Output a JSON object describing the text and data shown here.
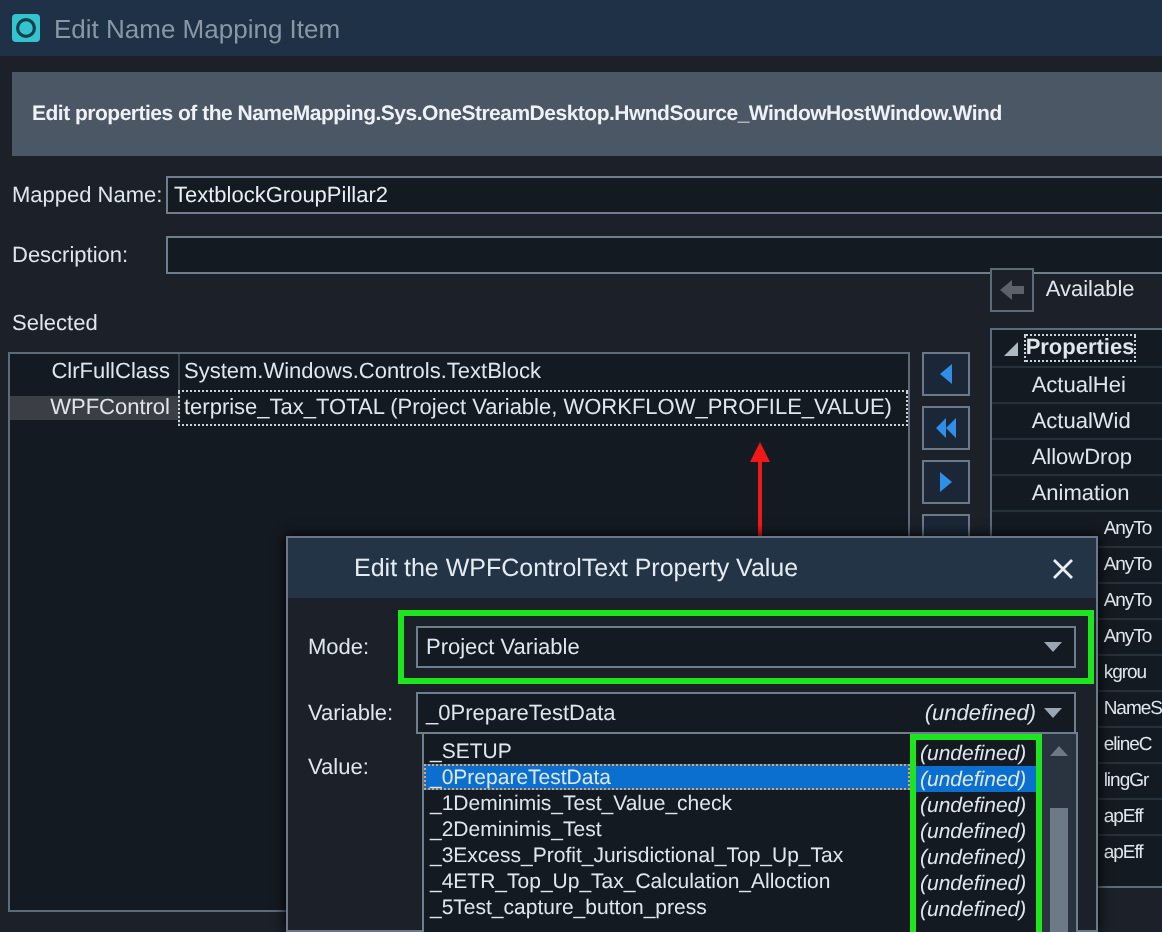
{
  "window": {
    "title": "Edit Name Mapping Item"
  },
  "header": "Edit properties of the NameMapping.Sys.OneStreamDesktop.HwndSource_WindowHostWindow.Wind",
  "fields": [
    {
      "label": "Mapped Name:",
      "value": "TextblockGroupPillar2"
    },
    {
      "label": "Description:"
    }
  ],
  "selected": {
    "label": "Selected",
    "rows": [
      {
        "name": "ClrFullClass",
        "value": "System.Windows.Controls.TextBlock",
        "selected": false
      },
      {
        "name": "WPFControl",
        "value": "terprise_Tax_TOTAL (Project Variable, WORKFLOW_PROFILE_VALUE)",
        "selected": true
      }
    ]
  },
  "available": {
    "label": "Available",
    "group": "Properties",
    "expanded": true,
    "items": [
      "ActualHei",
      "ActualWid",
      "AllowDrop",
      "Animation",
      "AnyTo",
      "AnyTo",
      "AnyTo",
      "AnyTo",
      "kgrou",
      "NameS",
      "elineC",
      "lingGr",
      "apEff",
      "apEff"
    ]
  },
  "dialog": {
    "title": "Edit the WPFControlText Property Value",
    "mode": {
      "label": "Mode:",
      "value": "Project Variable"
    },
    "variable": {
      "label": "Variable:",
      "value": "_0PrepareTestData",
      "scope": "(undefined)"
    },
    "value_label": "Value:",
    "options": [
      {
        "name": "_SETUP",
        "scope": "(undefined)",
        "selected": false
      },
      {
        "name": "_0PrepareTestData",
        "scope": "(undefined)",
        "selected": true
      },
      {
        "name": "_1Deminimis_Test_Value_check",
        "scope": "(undefined)",
        "selected": false
      },
      {
        "name": "_2Deminimis_Test",
        "scope": "(undefined)",
        "selected": false
      },
      {
        "name": "_3Excess_Profit_Jurisdictional_Top_Up_Tax",
        "scope": "(undefined)",
        "selected": false
      },
      {
        "name": "_4ETR_Top_Up_Tax_Calculation_Alloction",
        "scope": "(undefined)",
        "selected": false
      },
      {
        "name": "_5Test_capture_button_press",
        "scope": "(undefined)",
        "selected": false
      }
    ]
  }
}
